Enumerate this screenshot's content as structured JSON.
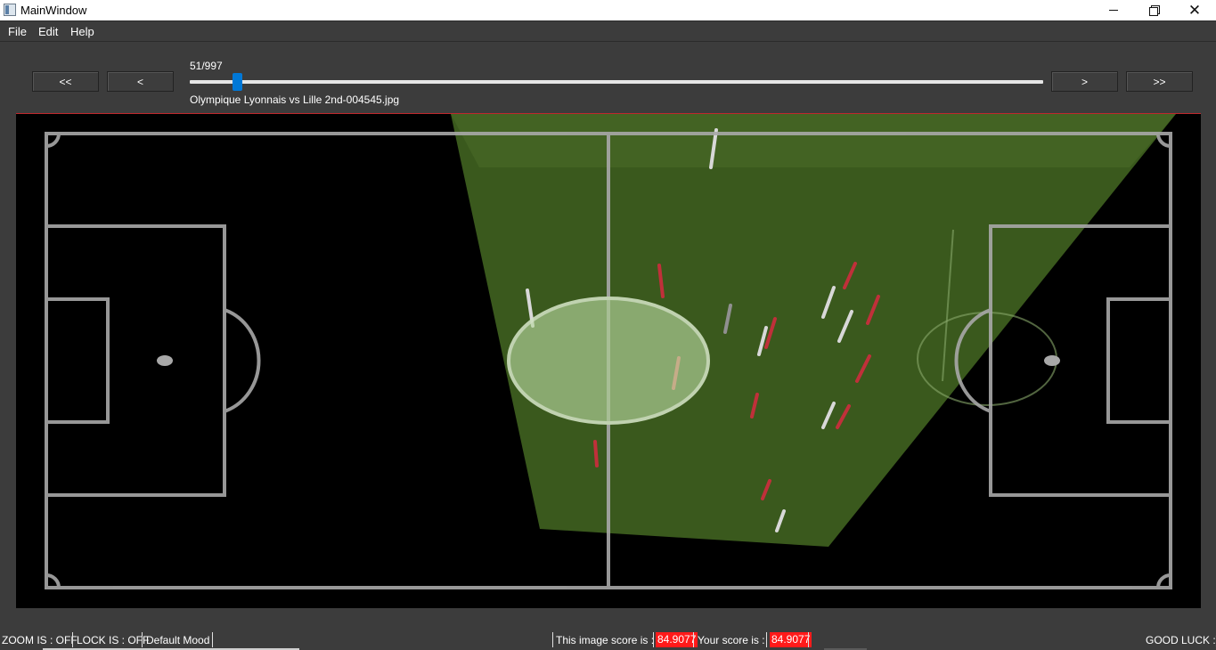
{
  "window": {
    "title": "MainWindow",
    "controls": {
      "minimize": "minimize-icon",
      "maximize": "restore-icon",
      "close": "close-icon"
    }
  },
  "menu": {
    "file": "File",
    "edit": "Edit",
    "help": "Help"
  },
  "navigation": {
    "first_label": "<<",
    "prev_label": "<",
    "next_label": ">",
    "last_label": ">>",
    "frame_counter": "51/997",
    "current_frame": 51,
    "total_frames": 997,
    "filename": "Olympique Lyonnais vs Lille 2nd-004545.jpg"
  },
  "viewport": {
    "description_icon": "soccer-pitch-overlay",
    "accent_color": "#c0282d",
    "pitch_line_color": "#a8a8a8",
    "overlay_color": "#3b5a1e"
  },
  "status": {
    "zoom": "ZOOM IS : OFF",
    "lock": "LOCK IS : OFF",
    "mood": "Default Mood",
    "image_score_label": "This image score is :",
    "image_score": "84.9077",
    "your_score_label": "Your score is :",
    "your_score": "84.9077",
    "good_luck": "GOOD LUCK :)",
    "score_color": "#ff1a1a"
  }
}
